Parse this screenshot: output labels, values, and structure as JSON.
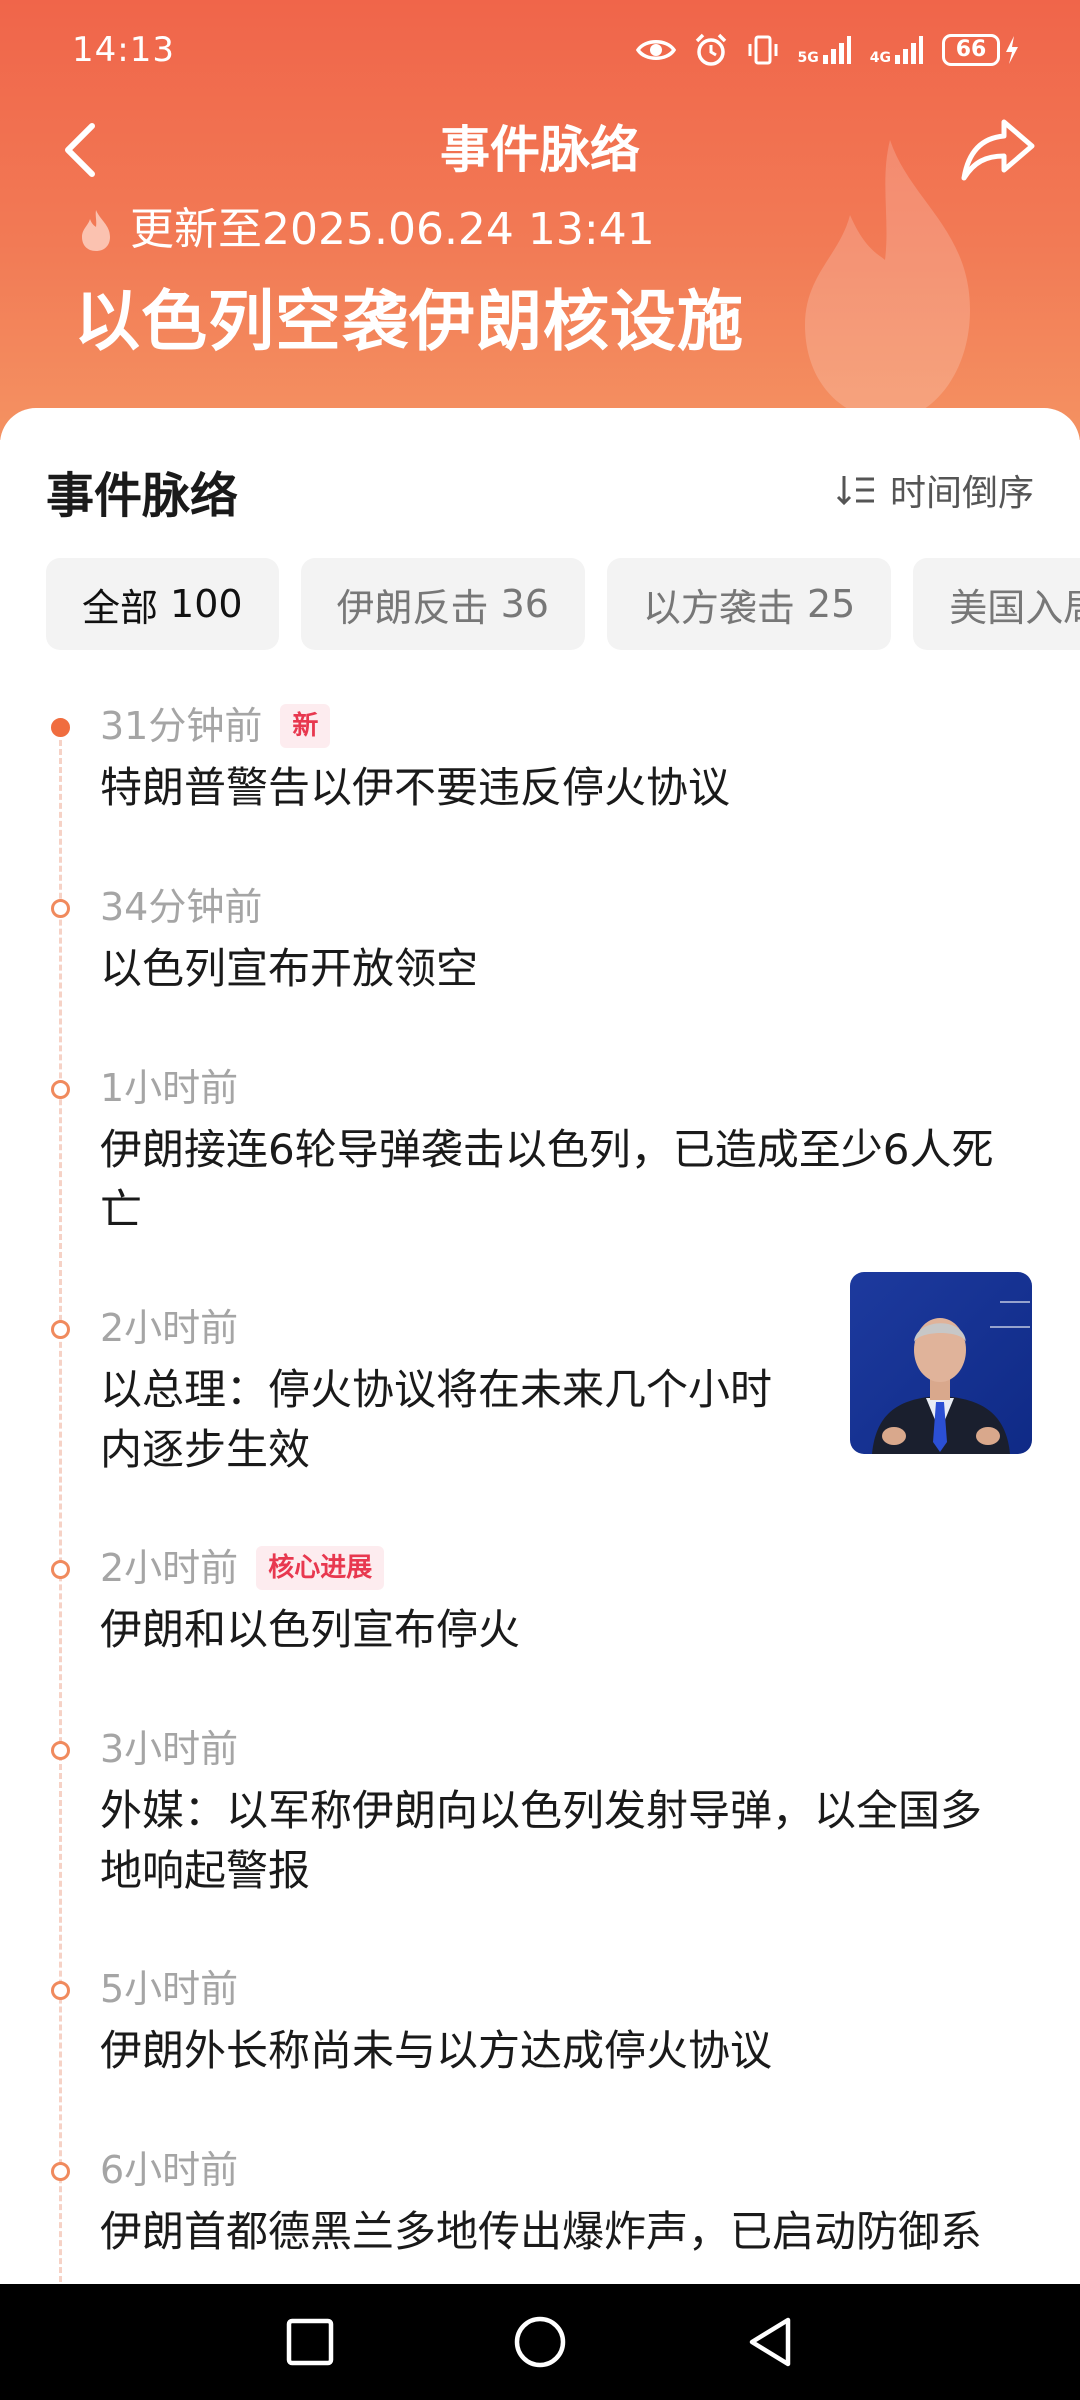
{
  "status_bar": {
    "time": "14:13",
    "sig1_label": "5G",
    "sig2_label": "4G",
    "battery": "66"
  },
  "nav": {
    "title": "事件脉络",
    "back_icon": "chevron-left-icon",
    "share_icon": "share-arrow-icon"
  },
  "event": {
    "update_text": "更新至2025.06.24 13:41",
    "title": "以色列空袭伊朗核设施"
  },
  "section": {
    "title": "事件脉络",
    "sort_label": "时间倒序"
  },
  "filters": [
    {
      "label": "全部",
      "count": "100"
    },
    {
      "label": "伊朗反击",
      "count": "36"
    },
    {
      "label": "以方袭击",
      "count": "25"
    },
    {
      "label": "美国入局",
      "count": ""
    }
  ],
  "timeline": [
    {
      "time": "31分钟前",
      "badge": "新",
      "lines": [
        "特朗普警告以伊不要违反停火协议"
      ]
    },
    {
      "time": "34分钟前",
      "badge": "",
      "lines": [
        "以色列宣布开放领空"
      ]
    },
    {
      "time": "1小时前",
      "badge": "",
      "lines": [
        "伊朗接连6轮导弹袭击以色列，已造成至少6人死",
        "亡"
      ]
    },
    {
      "time": "2小时前",
      "badge": "",
      "lines": [
        "以总理：停火协议将在未来几个小时",
        "内逐步生效"
      ]
    },
    {
      "time": "2小时前",
      "badge": "核心进展",
      "lines": [
        "伊朗和以色列宣布停火"
      ]
    },
    {
      "time": "3小时前",
      "badge": "",
      "lines": [
        "外媒：以军称伊朗向以色列发射导弹，以全国多",
        "地响起警报"
      ]
    },
    {
      "time": "5小时前",
      "badge": "",
      "lines": [
        "伊朗外长称尚未与以方达成停火协议"
      ]
    },
    {
      "time": "6小时前",
      "badge": "",
      "lines": [
        "伊朗首都德黑兰多地传出爆炸声，已启动防御系"
      ]
    }
  ],
  "colors": {
    "header_top": "#f0654a",
    "accent": "#f06d3f",
    "badge_text": "#e8384f",
    "badge_bg": "#fdecef"
  }
}
